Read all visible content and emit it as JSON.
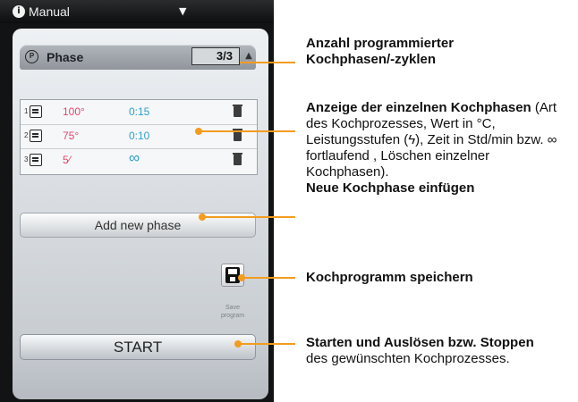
{
  "screen": {
    "mode_selector": {
      "icon": "info-circle-icon",
      "label": "Manual",
      "caret": "▼"
    },
    "phase_header": {
      "icon": "program-p-icon",
      "icon_glyph": "P",
      "title": "Phase",
      "count": "3/3",
      "arrow": "▲"
    },
    "phases": [
      {
        "num": "1",
        "type_icon": "hot-air-icon",
        "value": "100°",
        "time": "0:15",
        "delete_icon": "trash-icon"
      },
      {
        "num": "2",
        "type_icon": "hot-air-icon",
        "value": "75°",
        "time": "0:10",
        "delete_icon": "trash-icon"
      },
      {
        "num": "3",
        "type_icon": "hot-air-icon",
        "value": "5⁄",
        "time": "∞",
        "delete_icon": "trash-icon"
      }
    ],
    "add_phase_label": "Add new phase",
    "save": {
      "icon": "floppy-disk-icon",
      "line1": "Save",
      "line2": "program"
    },
    "start_label": "START"
  },
  "annotations": {
    "phase_count": {
      "bold": "Anzahl programmierter Kochphasen/-zyklen"
    },
    "phases": {
      "bold": "Anzeige der einzelnen Kochphasen",
      "normal": " (Art des Kochprozesses, Wert in °C, Leistungsstufen (ϟ),  Zeit in Std/min bzw. ∞ fortlaufend , Löschen einzelner Kochphasen)."
    },
    "add_phase": {
      "bold": "Neue Kochphase einfügen"
    },
    "save": {
      "bold": "Kochprogramm speichern"
    },
    "start": {
      "bold": "Starten und Auslösen bzw. Stoppen",
      "normal": " des gewünschten Kochprozesses."
    }
  },
  "colors": {
    "accent_orange": "#f39c1e",
    "value_pink": "#e3466e",
    "time_blue": "#2da1cc"
  }
}
